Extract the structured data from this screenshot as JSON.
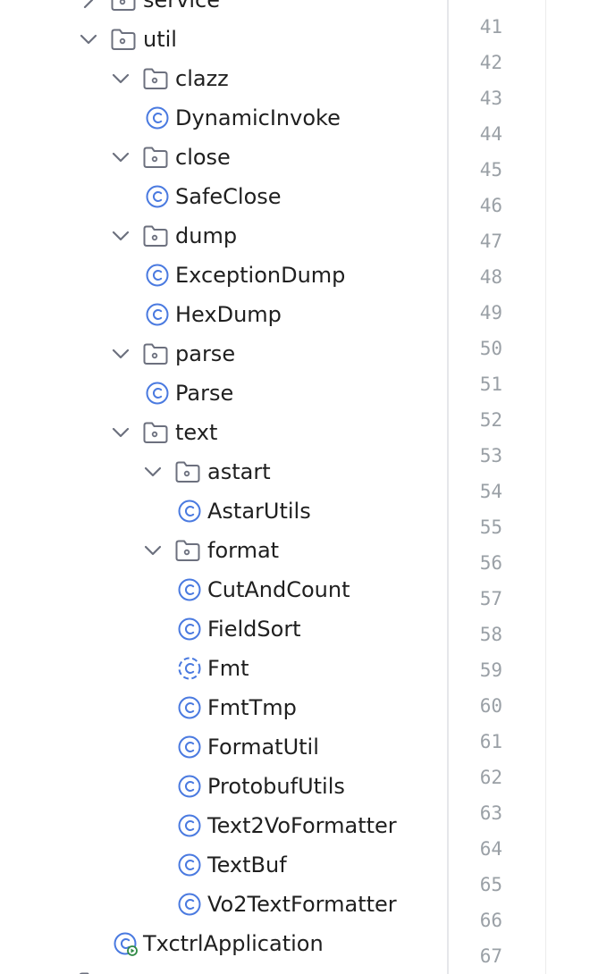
{
  "tree": {
    "items": [
      {
        "label": "service",
        "kind": "folder",
        "expanded": false,
        "depth": 2
      },
      {
        "label": "util",
        "kind": "folder",
        "expanded": true,
        "depth": 2
      },
      {
        "label": "clazz",
        "kind": "folder",
        "expanded": true,
        "depth": 3
      },
      {
        "label": "DynamicInvoke",
        "kind": "class",
        "depth": 4
      },
      {
        "label": "close",
        "kind": "folder",
        "expanded": true,
        "depth": 3
      },
      {
        "label": "SafeClose",
        "kind": "class",
        "depth": 4
      },
      {
        "label": "dump",
        "kind": "folder",
        "expanded": true,
        "depth": 3
      },
      {
        "label": "ExceptionDump",
        "kind": "class",
        "depth": 4
      },
      {
        "label": "HexDump",
        "kind": "class",
        "depth": 4
      },
      {
        "label": "parse",
        "kind": "folder",
        "expanded": true,
        "depth": 3
      },
      {
        "label": "Parse",
        "kind": "class",
        "depth": 4
      },
      {
        "label": "text",
        "kind": "folder",
        "expanded": true,
        "depth": 3
      },
      {
        "label": "astart",
        "kind": "folder",
        "expanded": true,
        "depth": 4
      },
      {
        "label": "AstarUtils",
        "kind": "class",
        "depth": 5
      },
      {
        "label": "format",
        "kind": "folder",
        "expanded": true,
        "depth": 4
      },
      {
        "label": "CutAndCount",
        "kind": "class",
        "depth": 5
      },
      {
        "label": "FieldSort",
        "kind": "class",
        "depth": 5
      },
      {
        "label": "Fmt",
        "kind": "class-abstract",
        "depth": 5
      },
      {
        "label": "FmtTmp",
        "kind": "class",
        "depth": 5
      },
      {
        "label": "FormatUtil",
        "kind": "class",
        "depth": 5
      },
      {
        "label": "ProtobufUtils",
        "kind": "class",
        "depth": 5
      },
      {
        "label": "Text2VoFormatter",
        "kind": "class",
        "depth": 5
      },
      {
        "label": "TextBuf",
        "kind": "class",
        "depth": 5
      },
      {
        "label": "Vo2TextFormatter",
        "kind": "class",
        "depth": 5
      },
      {
        "label": "TxctrlApplication",
        "kind": "class-runnable",
        "depth": 3
      },
      {
        "label": "",
        "kind": "folder",
        "expanded": false,
        "depth": 1
      }
    ]
  },
  "gutter": {
    "line_numbers": [
      "41",
      "42",
      "43",
      "44",
      "45",
      "46",
      "47",
      "48",
      "49",
      "50",
      "51",
      "52",
      "53",
      "54",
      "55",
      "56",
      "57",
      "58",
      "59",
      "60",
      "61",
      "62",
      "63",
      "64",
      "65",
      "66",
      "67"
    ]
  },
  "colors": {
    "class_icon": "#4a7ae0",
    "folder_icon": "#6c707e",
    "chevron": "#6c707e",
    "text": "#1f1f1f",
    "line_number": "#9aa0a6",
    "runnable_badge": "#2f8a45"
  }
}
